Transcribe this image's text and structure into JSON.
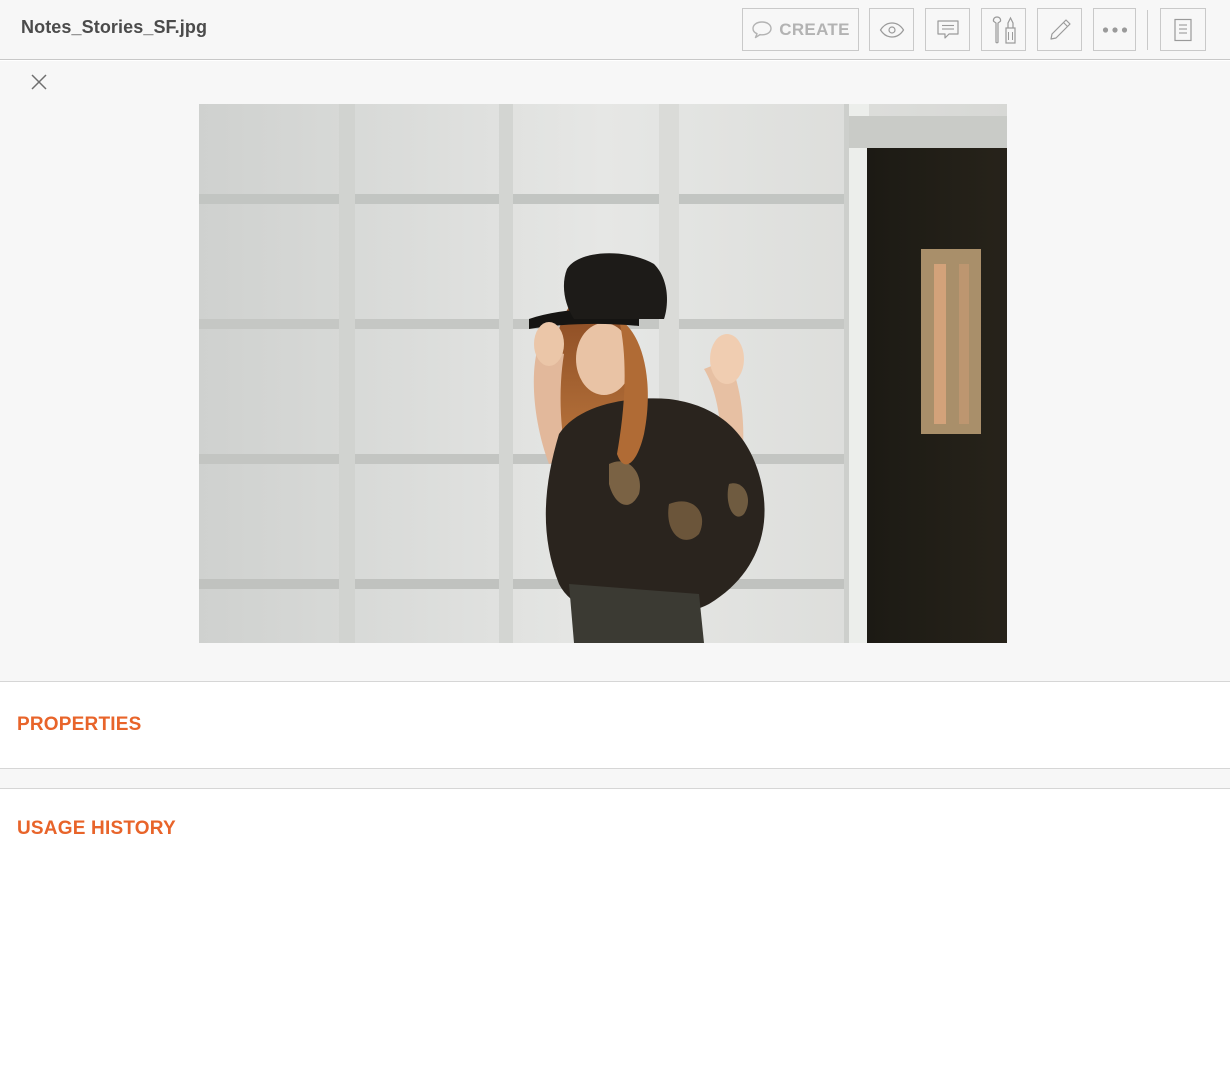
{
  "header": {
    "file_name": "Notes_Stories_SF.jpg",
    "toolbar": {
      "create_label": "CREATE",
      "buttons": [
        {
          "name": "create-button",
          "icon": "speech-bubble-icon"
        },
        {
          "name": "preview-button",
          "icon": "eye-icon"
        },
        {
          "name": "comments-button",
          "icon": "comment-icon"
        },
        {
          "name": "tools-button",
          "icon": "tools-icon"
        },
        {
          "name": "edit-button",
          "icon": "pencil-icon"
        },
        {
          "name": "more-button",
          "icon": "ellipsis-icon"
        },
        {
          "name": "details-button",
          "icon": "document-icon"
        }
      ]
    }
  },
  "viewer": {
    "close_icon": "close-icon",
    "image_subject": "photo"
  },
  "sections": {
    "properties_label": "PROPERTIES",
    "usage_history_label": "USAGE HISTORY"
  },
  "colors": {
    "accent": "#e8642a",
    "toolbar_bg": "#f7f7f7",
    "icon_gray": "#9a9a9a",
    "border": "#c9c9c9"
  }
}
